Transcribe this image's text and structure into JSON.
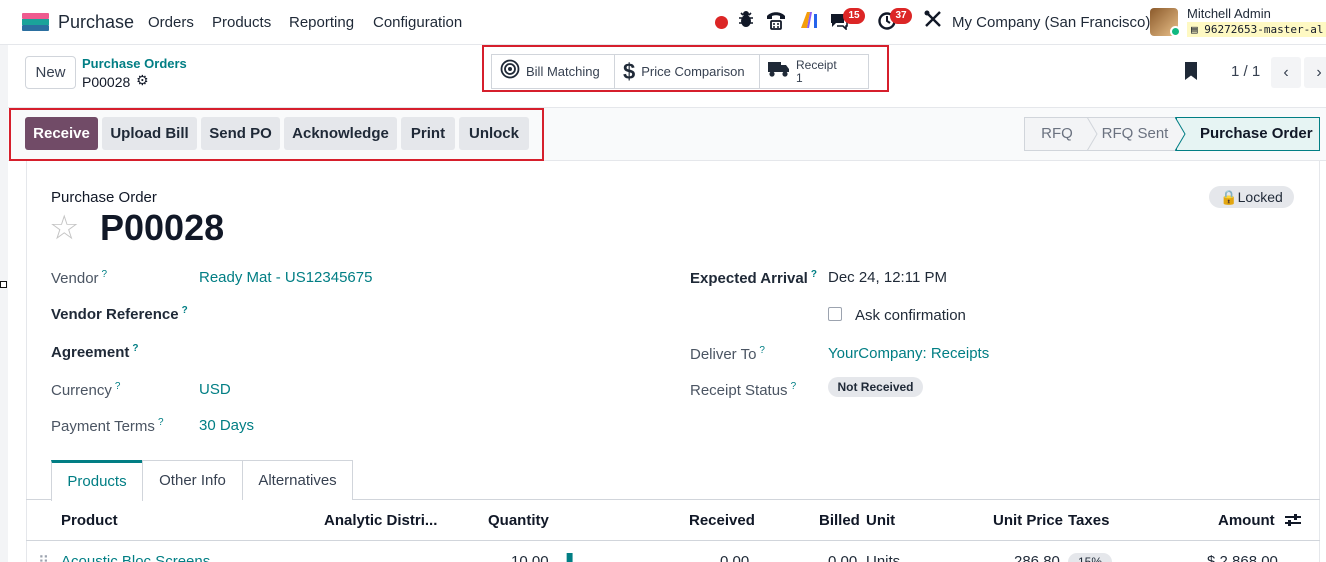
{
  "app": {
    "name": "Purchase",
    "menu": [
      "Orders",
      "Products",
      "Reporting",
      "Configuration"
    ],
    "discuss_count": "15",
    "activity_count": "37",
    "company": "My Company (San Francisco)",
    "user_name": "Mitchell Admin",
    "db_name": "96272653-master-al",
    "colors": {
      "brand": "#714b67",
      "link": "#017e84",
      "badge": "#dc2626",
      "highlight_box": "#d61f2c"
    }
  },
  "control_panel": {
    "new_label": "New",
    "breadcrumb_parent": "Purchase Orders",
    "breadcrumb_current": "P00028",
    "smart_buttons": [
      {
        "label": "Bill Matching",
        "icon": "target-icon"
      },
      {
        "label": "Price Comparison",
        "icon": "dollar-icon"
      },
      {
        "label": "Receipt",
        "value": "1",
        "icon": "truck-icon"
      }
    ],
    "pager": "1 / 1"
  },
  "actions": [
    "Receive",
    "Upload Bill",
    "Send PO",
    "Acknowledge",
    "Print",
    "Unlock"
  ],
  "statusbar": [
    "RFQ",
    "RFQ Sent",
    "Purchase Order"
  ],
  "form": {
    "title_label": "Purchase Order",
    "name": "P00028",
    "locked_label": "Locked",
    "help": "?",
    "left_fields": [
      {
        "label": "Vendor",
        "value": "Ready Mat - US12345675"
      },
      {
        "label": "Vendor Reference",
        "value": ""
      },
      {
        "label": "Agreement",
        "value": ""
      },
      {
        "label": "Currency",
        "value": "USD"
      },
      {
        "label": "Payment Terms",
        "value": "30 Days"
      }
    ],
    "right_fields": [
      {
        "label": "Expected Arrival",
        "value": "Dec 24, 12:11 PM"
      },
      {
        "label": "Ask confirmation",
        "value": ""
      },
      {
        "label": "Deliver To",
        "value": "YourCompany: Receipts"
      },
      {
        "label": "Receipt Status",
        "value": "Not Received"
      }
    ]
  },
  "tabs": [
    "Products",
    "Other Info",
    "Alternatives"
  ],
  "table": {
    "columns": [
      "Product",
      "Analytic Distri...",
      "Quantity",
      "Received",
      "Billed",
      "Unit",
      "Unit Price",
      "Taxes",
      "Amount"
    ],
    "rows": [
      {
        "product": "Acoustic Bloc Screens",
        "quantity": "10.00",
        "received": "0.00",
        "billed": "0.00",
        "unit": "Units",
        "unit_price": "286.80",
        "taxes": "15%",
        "amount": "$ 2,868.00"
      }
    ]
  }
}
